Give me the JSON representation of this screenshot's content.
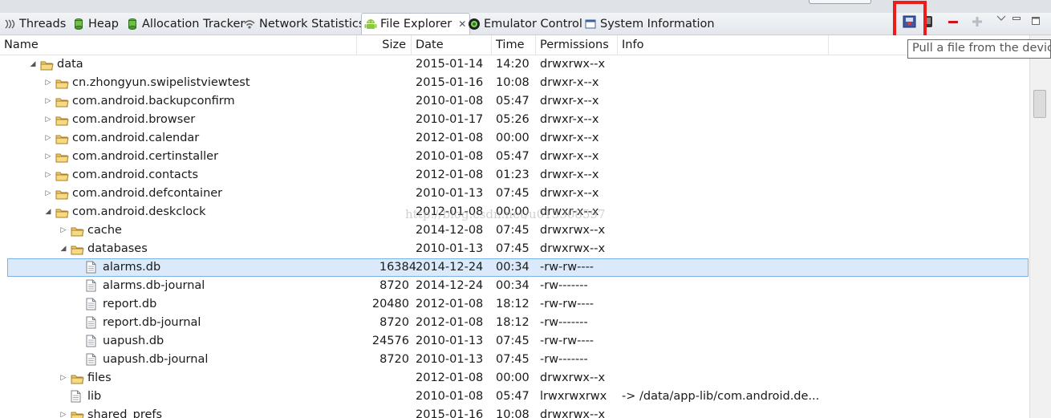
{
  "tabs": [
    {
      "label": "Threads",
      "icon": "threads-icon"
    },
    {
      "label": "Heap",
      "icon": "heap-icon"
    },
    {
      "label": "Allocation Tracker",
      "icon": "allocation-icon"
    },
    {
      "label": "Network Statistics",
      "icon": "wifi-icon"
    },
    {
      "label": "File Explorer",
      "icon": "android-icon",
      "active": true,
      "close": "✕"
    },
    {
      "label": "Emulator Control",
      "icon": "emulator-icon"
    },
    {
      "label": "System Information",
      "icon": "window-icon"
    }
  ],
  "toolbar": {
    "tooltip": "Pull a file from the device"
  },
  "columns": {
    "name": "Name",
    "size": "Size",
    "date": "Date",
    "time": "Time",
    "permissions": "Permissions",
    "info": "Info"
  },
  "rows": [
    {
      "name": "data",
      "type": "folder",
      "depth": 0,
      "state": "expanded",
      "size": "",
      "date": "2015-01-14",
      "time": "14:20",
      "perm": "drwxrwx--x",
      "info": ""
    },
    {
      "name": "cn.zhongyun.swipelistviewtest",
      "type": "folder",
      "depth": 1,
      "state": "collapsed",
      "size": "",
      "date": "2015-01-16",
      "time": "10:08",
      "perm": "drwxr-x--x",
      "info": ""
    },
    {
      "name": "com.android.backupconfirm",
      "type": "folder",
      "depth": 1,
      "state": "collapsed",
      "size": "",
      "date": "2010-01-08",
      "time": "05:47",
      "perm": "drwxr-x--x",
      "info": ""
    },
    {
      "name": "com.android.browser",
      "type": "folder",
      "depth": 1,
      "state": "collapsed",
      "size": "",
      "date": "2010-01-17",
      "time": "05:26",
      "perm": "drwxr-x--x",
      "info": ""
    },
    {
      "name": "com.android.calendar",
      "type": "folder",
      "depth": 1,
      "state": "collapsed",
      "size": "",
      "date": "2012-01-08",
      "time": "00:00",
      "perm": "drwxr-x--x",
      "info": ""
    },
    {
      "name": "com.android.certinstaller",
      "type": "folder",
      "depth": 1,
      "state": "collapsed",
      "size": "",
      "date": "2010-01-08",
      "time": "05:47",
      "perm": "drwxr-x--x",
      "info": ""
    },
    {
      "name": "com.android.contacts",
      "type": "folder",
      "depth": 1,
      "state": "collapsed",
      "size": "",
      "date": "2012-01-08",
      "time": "01:23",
      "perm": "drwxr-x--x",
      "info": ""
    },
    {
      "name": "com.android.defcontainer",
      "type": "folder",
      "depth": 1,
      "state": "collapsed",
      "size": "",
      "date": "2010-01-13",
      "time": "07:45",
      "perm": "drwxr-x--x",
      "info": ""
    },
    {
      "name": "com.android.deskclock",
      "type": "folder",
      "depth": 1,
      "state": "expanded",
      "size": "",
      "date": "2012-01-08",
      "time": "00:00",
      "perm": "drwxr-x--x",
      "info": ""
    },
    {
      "name": "cache",
      "type": "folder",
      "depth": 2,
      "state": "collapsed",
      "size": "",
      "date": "2014-12-08",
      "time": "07:45",
      "perm": "drwxrwx--x",
      "info": ""
    },
    {
      "name": "databases",
      "type": "folder",
      "depth": 2,
      "state": "expanded",
      "size": "",
      "date": "2010-01-13",
      "time": "07:45",
      "perm": "drwxrwx--x",
      "info": ""
    },
    {
      "name": "alarms.db",
      "type": "file",
      "depth": 3,
      "state": "none",
      "size": "16384",
      "date": "2014-12-24",
      "time": "00:34",
      "perm": "-rw-rw----",
      "info": "",
      "selected": true
    },
    {
      "name": "alarms.db-journal",
      "type": "file",
      "depth": 3,
      "state": "none",
      "size": "8720",
      "date": "2014-12-24",
      "time": "00:34",
      "perm": "-rw-------",
      "info": ""
    },
    {
      "name": "report.db",
      "type": "file",
      "depth": 3,
      "state": "none",
      "size": "20480",
      "date": "2012-01-08",
      "time": "18:12",
      "perm": "-rw-rw----",
      "info": ""
    },
    {
      "name": "report.db-journal",
      "type": "file",
      "depth": 3,
      "state": "none",
      "size": "8720",
      "date": "2012-01-08",
      "time": "18:12",
      "perm": "-rw-------",
      "info": ""
    },
    {
      "name": "uapush.db",
      "type": "file",
      "depth": 3,
      "state": "none",
      "size": "24576",
      "date": "2010-01-13",
      "time": "07:45",
      "perm": "-rw-rw----",
      "info": ""
    },
    {
      "name": "uapush.db-journal",
      "type": "file",
      "depth": 3,
      "state": "none",
      "size": "8720",
      "date": "2010-01-13",
      "time": "07:45",
      "perm": "-rw-------",
      "info": ""
    },
    {
      "name": "files",
      "type": "folder",
      "depth": 2,
      "state": "collapsed",
      "size": "",
      "date": "2012-01-08",
      "time": "00:00",
      "perm": "drwxrwx--x",
      "info": ""
    },
    {
      "name": "lib",
      "type": "file",
      "depth": 2,
      "state": "none",
      "size": "",
      "date": "2010-01-08",
      "time": "05:47",
      "perm": "lrwxrwxrwx",
      "info": "-> /data/app-lib/com.android.de..."
    },
    {
      "name": "shared_prefs",
      "type": "folder",
      "depth": 2,
      "state": "collapsed",
      "size": "",
      "date": "2015-01-16",
      "time": "10:08",
      "perm": "drwxrwx--x",
      "info": ""
    }
  ],
  "watermark": "http://blog.csdn.net/u013308597",
  "colors": {
    "folder": "#e8b84a",
    "selection": "#dbeafa",
    "highlight": "#ef1b1b"
  }
}
